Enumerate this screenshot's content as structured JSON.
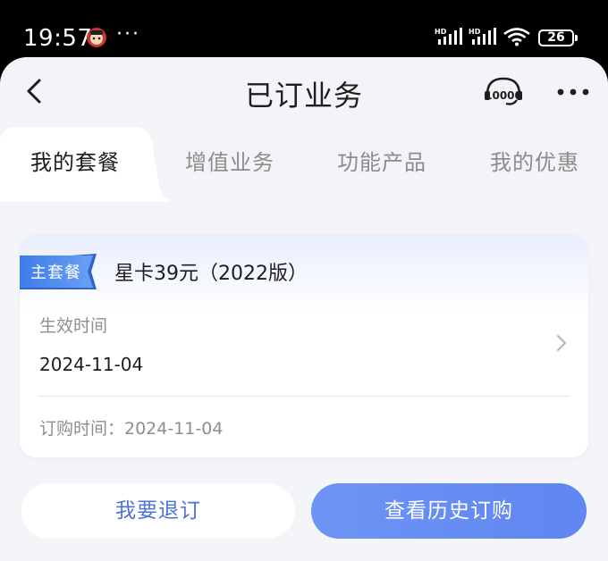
{
  "status_bar": {
    "time": "19:57",
    "more": "···",
    "network_1": "HD",
    "network_2": "HD",
    "battery": "26"
  },
  "header": {
    "title": "已订业务",
    "service_icon_text": "10000"
  },
  "tabs": [
    {
      "label": "我的套餐",
      "active": true
    },
    {
      "label": "增值业务",
      "active": false
    },
    {
      "label": "功能产品",
      "active": false
    },
    {
      "label": "我的优惠",
      "active": false
    }
  ],
  "plan_card": {
    "badge": "主套餐",
    "name": "星卡39元（2022版）",
    "effective_label": "生效时间",
    "effective_date": "2024-11-04",
    "order_time": "订购时间：2024-11-04"
  },
  "actions": {
    "unsubscribe": "我要退订",
    "history": "查看历史订购"
  },
  "colors": {
    "accent": "#5f86f1",
    "accent_text": "#4b73d9",
    "background": "#f3f4f8",
    "card": "#ffffff"
  }
}
